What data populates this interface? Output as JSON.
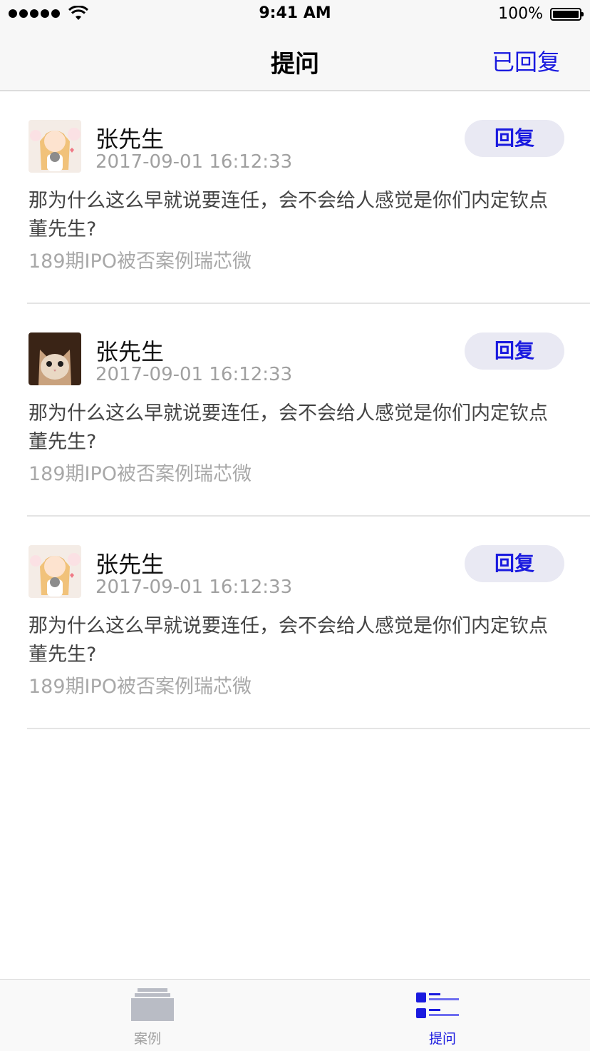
{
  "status_bar": {
    "time": "9:41 AM",
    "battery": "100%"
  },
  "nav": {
    "title": "提问",
    "right_action": "已回复"
  },
  "questions": [
    {
      "name": "张先生",
      "time": "2017-09-01 16:12:33",
      "reply_label": "回复",
      "question": "那为什么这么早就说要连任，会不会给人感觉是你们内定钦点董先生?",
      "source": "189期IPO被否案例瑞芯微",
      "avatar": "anime-girl-avatar"
    },
    {
      "name": "张先生",
      "time": "2017-09-01 16:12:33",
      "reply_label": "回复",
      "question": "那为什么这么早就说要连任，会不会给人感觉是你们内定钦点董先生?",
      "source": "189期IPO被否案例瑞芯微",
      "avatar": "cat-avatar"
    },
    {
      "name": "张先生",
      "time": "2017-09-01 16:12:33",
      "reply_label": "回复",
      "question": "那为什么这么早就说要连任，会不会给人感觉是你们内定钦点董先生?",
      "source": "189期IPO被否案例瑞芯微",
      "avatar": "anime-girl-avatar"
    }
  ],
  "tabs": [
    {
      "label": "案例",
      "icon": "case-stack-icon",
      "active": false
    },
    {
      "label": "提问",
      "icon": "question-list-icon",
      "active": true
    }
  ],
  "colors": {
    "accent": "#1a1adf",
    "reply_bg": "#e9e9f3",
    "muted": "#a0a0a0"
  }
}
